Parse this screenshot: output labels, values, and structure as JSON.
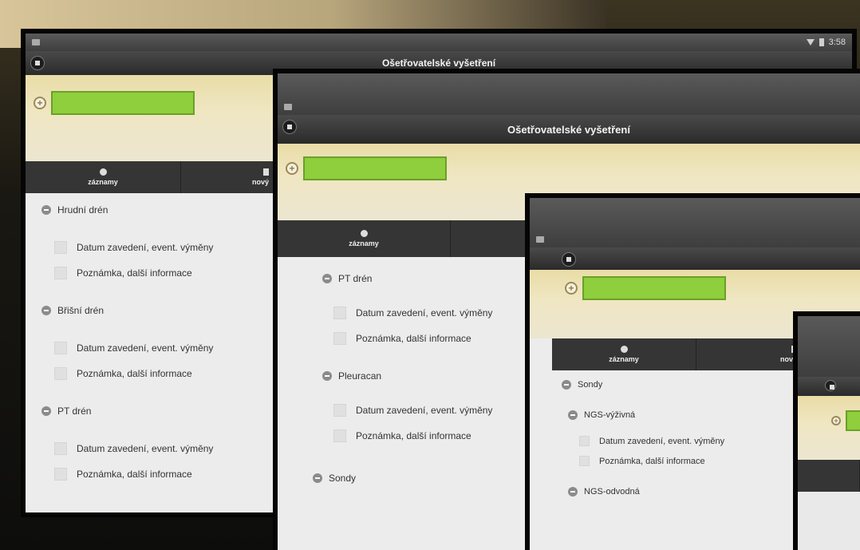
{
  "app": {
    "title": "Ošetřovatelské vyšetření",
    "status_time": "3:58",
    "tabs": {
      "records_label": "záznamy",
      "new_label": "nový"
    }
  },
  "fields": {
    "insertion_date": "Datum zavedení, event. výměny",
    "note": "Poznámka, další informace"
  },
  "screen1": {
    "sections": [
      "Hrudní drén",
      "Břišní drén",
      "PT drén"
    ]
  },
  "screen2": {
    "sections": [
      "PT drén",
      "Pleuracan",
      "Sondy"
    ]
  },
  "screen3": {
    "sections": [
      "Sondy",
      "NGS-výživná",
      "NGS-odvodná"
    ]
  },
  "colors": {
    "patient_box": "#8fce3c",
    "header_band": "#e9dca6",
    "title_bar": "#2a2a2a"
  }
}
